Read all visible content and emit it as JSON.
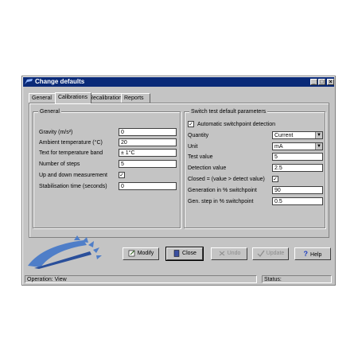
{
  "window": {
    "title": "Change defaults",
    "controls": {
      "minimize": "_",
      "maximize": "□",
      "close": "×"
    }
  },
  "tabs": [
    {
      "label": "General",
      "active": false
    },
    {
      "label": "Calibrations",
      "active": true
    },
    {
      "label": "Recalibration",
      "active": false
    },
    {
      "label": "Reports",
      "active": false
    }
  ],
  "general": {
    "title": "General",
    "gravity": {
      "label": "Gravity (m/s²)",
      "value": "0"
    },
    "ambient": {
      "label": "Ambient temperature (°C)",
      "value": "20"
    },
    "tempband": {
      "label": "Text for temperature band",
      "value": "± 1°C"
    },
    "steps": {
      "label": "Number of steps",
      "value": "5"
    },
    "updown": {
      "label": "Up and down measurement",
      "checked": true
    },
    "stabilisation": {
      "label": "Stabilisation time (seconds)",
      "value": "0"
    }
  },
  "switch": {
    "title": "Switch test default parameters",
    "auto": {
      "label": "Automatic switchpoint detection",
      "checked": true
    },
    "quantity": {
      "label": "Quantity",
      "value": "Current"
    },
    "unit": {
      "label": "Unit",
      "value": "mA"
    },
    "testvalue": {
      "label": "Test value",
      "value": "5"
    },
    "detection": {
      "label": "Detection value",
      "value": "2.5"
    },
    "closed": {
      "label": "Closed = (value > detect value)",
      "checked": true
    },
    "generation": {
      "label": "Generation in % switchpoint",
      "value": "90"
    },
    "genstep": {
      "label": "Gen. step in % switchpoint",
      "value": "0.5"
    }
  },
  "buttons": {
    "modify": "Modify",
    "close": "Close",
    "undo": "Undo",
    "update": "Update",
    "help": "Help"
  },
  "status": {
    "operation_label": "Operation:",
    "operation_value": "View",
    "status_label": "Status:"
  },
  "colors": {
    "titlebar": "#0a2a78",
    "window": "#c4c4c4",
    "logo": "#4f7ec8"
  }
}
